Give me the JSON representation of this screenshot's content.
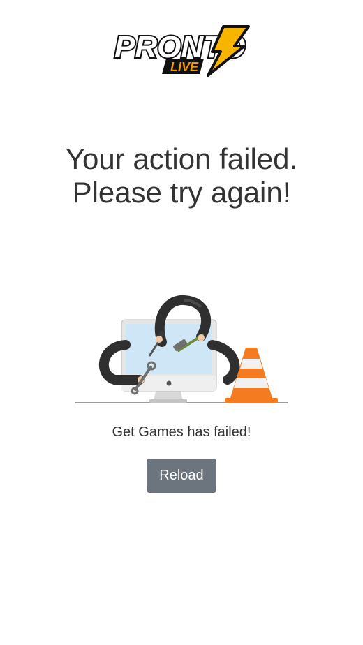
{
  "brand": {
    "logo_word": "PRONTO",
    "logo_sub": "LIVE"
  },
  "error": {
    "headline": "Your action failed. Please try again!",
    "message": "Get Games has failed!"
  },
  "actions": {
    "reload_label": "Reload"
  },
  "colors": {
    "button_bg": "#6c757d",
    "logo_bolt": "#f7b500",
    "logo_live": "#f29a00",
    "cone": "#f47b20",
    "screen": "#cfe6f7"
  },
  "icons": {
    "logo": "pronto-live-logo",
    "illustration": "broken-computer-repair-illustration",
    "cone": "traffic-cone-icon"
  }
}
